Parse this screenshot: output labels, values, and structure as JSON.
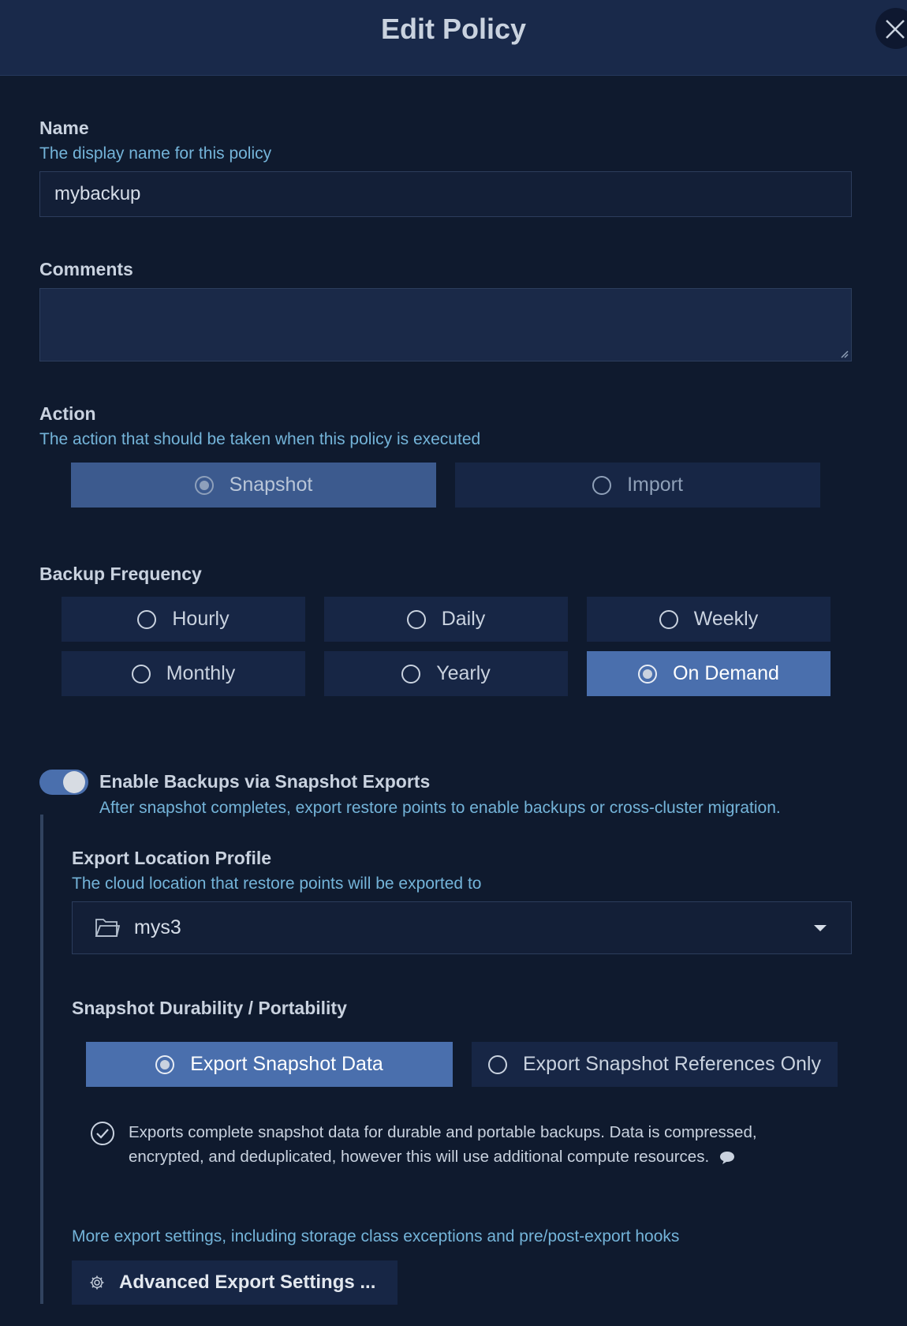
{
  "dialog": {
    "title": "Edit Policy"
  },
  "name": {
    "label": "Name",
    "help": "The display name for this policy",
    "value": "mybackup"
  },
  "comments": {
    "label": "Comments",
    "value": ""
  },
  "action": {
    "label": "Action",
    "help": "The action that should be taken when this policy is executed",
    "options": [
      "Snapshot",
      "Import"
    ],
    "selected": "Snapshot"
  },
  "frequency": {
    "label": "Backup Frequency",
    "options": [
      "Hourly",
      "Daily",
      "Weekly",
      "Monthly",
      "Yearly",
      "On Demand"
    ],
    "selected": "On Demand"
  },
  "exports": {
    "toggle_on": true,
    "label": "Enable Backups via Snapshot Exports",
    "help": "After snapshot completes, export restore points to enable backups or cross-cluster migration.",
    "location": {
      "label": "Export Location Profile",
      "help": "The cloud location that restore points will be exported to",
      "value": "mys3"
    },
    "durability": {
      "label": "Snapshot Durability / Portability",
      "options": [
        "Export Snapshot Data",
        "Export Snapshot References Only"
      ],
      "selected": "Export Snapshot Data",
      "description_line1": "Exports complete snapshot data for durable and portable backups. Data is compressed,",
      "description_line2": "encrypted, and deduplicated, however this will use additional compute resources."
    },
    "advanced": {
      "help": "More export settings, including storage class exceptions and pre/post-export hooks",
      "button_label": "Advanced Export Settings ..."
    }
  },
  "icons": {
    "close": "close-icon",
    "folder": "folder-icon",
    "caret": "chevron-down-icon",
    "check": "check-circle-icon",
    "comment": "comment-icon",
    "gear": "gear-icon"
  },
  "colors": {
    "background": "#0f1a2e",
    "header": "#19294a",
    "accent": "#4a6fad",
    "help_text": "#74b4d9"
  }
}
